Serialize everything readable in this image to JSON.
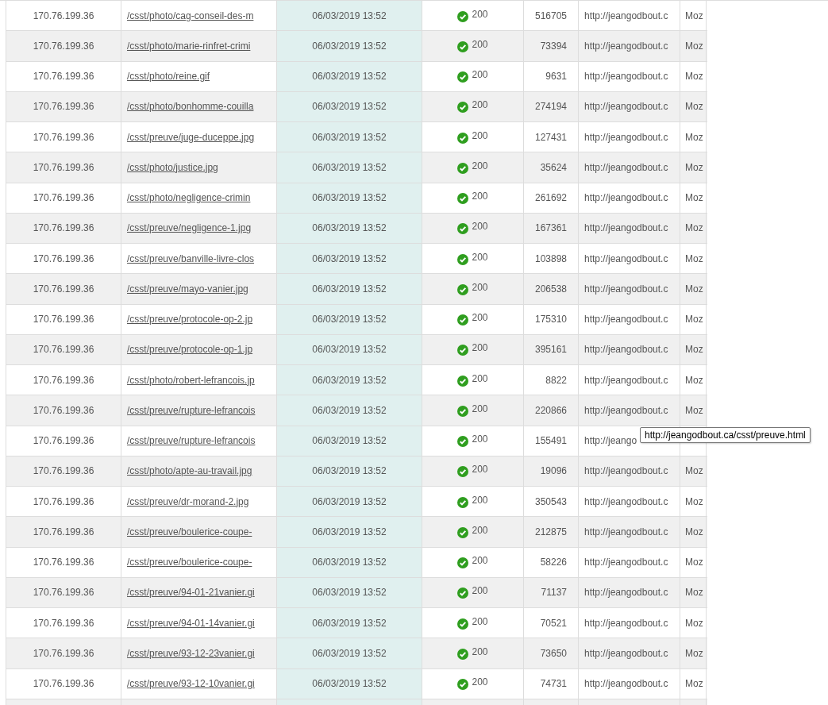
{
  "rows": [
    {
      "ip": "170.76.199.36",
      "path": "/csst/photo/cag-conseil-des-m",
      "time": "06/03/2019 13:52",
      "status": "200",
      "size": "516705",
      "referer": "http://jeangodbout.c",
      "agent": "Moz"
    },
    {
      "ip": "170.76.199.36",
      "path": "/csst/photo/marie-rinfret-crimi",
      "time": "06/03/2019 13:52",
      "status": "200",
      "size": "73394",
      "referer": "http://jeangodbout.c",
      "agent": "Moz"
    },
    {
      "ip": "170.76.199.36",
      "path": "/csst/photo/reine.gif",
      "time": "06/03/2019 13:52",
      "status": "200",
      "size": "9631",
      "referer": "http://jeangodbout.c",
      "agent": "Moz"
    },
    {
      "ip": "170.76.199.36",
      "path": "/csst/photo/bonhomme-couilla",
      "time": "06/03/2019 13:52",
      "status": "200",
      "size": "274194",
      "referer": "http://jeangodbout.c",
      "agent": "Moz"
    },
    {
      "ip": "170.76.199.36",
      "path": "/csst/preuve/juge-duceppe.jpg",
      "time": "06/03/2019 13:52",
      "status": "200",
      "size": "127431",
      "referer": "http://jeangodbout.c",
      "agent": "Moz"
    },
    {
      "ip": "170.76.199.36",
      "path": "/csst/photo/justice.jpg",
      "time": "06/03/2019 13:52",
      "status": "200",
      "size": "35624",
      "referer": "http://jeangodbout.c",
      "agent": "Moz"
    },
    {
      "ip": "170.76.199.36",
      "path": "/csst/photo/negligence-crimin",
      "time": "06/03/2019 13:52",
      "status": "200",
      "size": "261692",
      "referer": "http://jeangodbout.c",
      "agent": "Moz"
    },
    {
      "ip": "170.76.199.36",
      "path": "/csst/preuve/negligence-1.jpg",
      "time": "06/03/2019 13:52",
      "status": "200",
      "size": "167361",
      "referer": "http://jeangodbout.c",
      "agent": "Moz"
    },
    {
      "ip": "170.76.199.36",
      "path": "/csst/preuve/banville-livre-clos",
      "time": "06/03/2019 13:52",
      "status": "200",
      "size": "103898",
      "referer": "http://jeangodbout.c",
      "agent": "Moz"
    },
    {
      "ip": "170.76.199.36",
      "path": "/csst/preuve/mayo-vanier.jpg",
      "time": "06/03/2019 13:52",
      "status": "200",
      "size": "206538",
      "referer": "http://jeangodbout.c",
      "agent": "Moz"
    },
    {
      "ip": "170.76.199.36",
      "path": "/csst/preuve/protocole-op-2.jp",
      "time": "06/03/2019 13:52",
      "status": "200",
      "size": "175310",
      "referer": "http://jeangodbout.c",
      "agent": "Moz"
    },
    {
      "ip": "170.76.199.36",
      "path": "/csst/preuve/protocole-op-1.jp",
      "time": "06/03/2019 13:52",
      "status": "200",
      "size": "395161",
      "referer": "http://jeangodbout.c",
      "agent": "Moz"
    },
    {
      "ip": "170.76.199.36",
      "path": "/csst/photo/robert-lefrancois.jp",
      "time": "06/03/2019 13:52",
      "status": "200",
      "size": "8822",
      "referer": "http://jeangodbout.c",
      "agent": "Moz"
    },
    {
      "ip": "170.76.199.36",
      "path": "/csst/preuve/rupture-lefrancois",
      "time": "06/03/2019 13:52",
      "status": "200",
      "size": "220866",
      "referer": "http://jeangodbout.c",
      "agent": "Moz"
    },
    {
      "ip": "170.76.199.36",
      "path": "/csst/preuve/rupture-lefrancois",
      "time": "06/03/2019 13:52",
      "status": "200",
      "size": "155491",
      "referer": "http://jeango"
    },
    {
      "ip": "170.76.199.36",
      "path": "/csst/photo/apte-au-travail.jpg",
      "time": "06/03/2019 13:52",
      "status": "200",
      "size": "19096",
      "referer": "http://jeangodbout.c",
      "agent": "Moz"
    },
    {
      "ip": "170.76.199.36",
      "path": "/csst/preuve/dr-morand-2.jpg",
      "time": "06/03/2019 13:52",
      "status": "200",
      "size": "350543",
      "referer": "http://jeangodbout.c",
      "agent": "Moz"
    },
    {
      "ip": "170.76.199.36",
      "path": "/csst/preuve/boulerice-coupe-",
      "time": "06/03/2019 13:52",
      "status": "200",
      "size": "212875",
      "referer": "http://jeangodbout.c",
      "agent": "Moz"
    },
    {
      "ip": "170.76.199.36",
      "path": "/csst/preuve/boulerice-coupe-",
      "time": "06/03/2019 13:52",
      "status": "200",
      "size": "58226",
      "referer": "http://jeangodbout.c",
      "agent": "Moz"
    },
    {
      "ip": "170.76.199.36",
      "path": "/csst/preuve/94-01-21vanier.gi",
      "time": "06/03/2019 13:52",
      "status": "200",
      "size": "71137",
      "referer": "http://jeangodbout.c",
      "agent": "Moz"
    },
    {
      "ip": "170.76.199.36",
      "path": "/csst/preuve/94-01-14vanier.gi",
      "time": "06/03/2019 13:52",
      "status": "200",
      "size": "70521",
      "referer": "http://jeangodbout.c",
      "agent": "Moz"
    },
    {
      "ip": "170.76.199.36",
      "path": "/csst/preuve/93-12-23vanier.gi",
      "time": "06/03/2019 13:52",
      "status": "200",
      "size": "73650",
      "referer": "http://jeangodbout.c",
      "agent": "Moz"
    },
    {
      "ip": "170.76.199.36",
      "path": "/csst/preuve/93-12-10vanier.gi",
      "time": "06/03/2019 13:52",
      "status": "200",
      "size": "74731",
      "referer": "http://jeangodbout.c",
      "agent": "Moz"
    }
  ],
  "tooltip": {
    "text": "http://jeangodbout.ca/csst/preuve.html"
  }
}
